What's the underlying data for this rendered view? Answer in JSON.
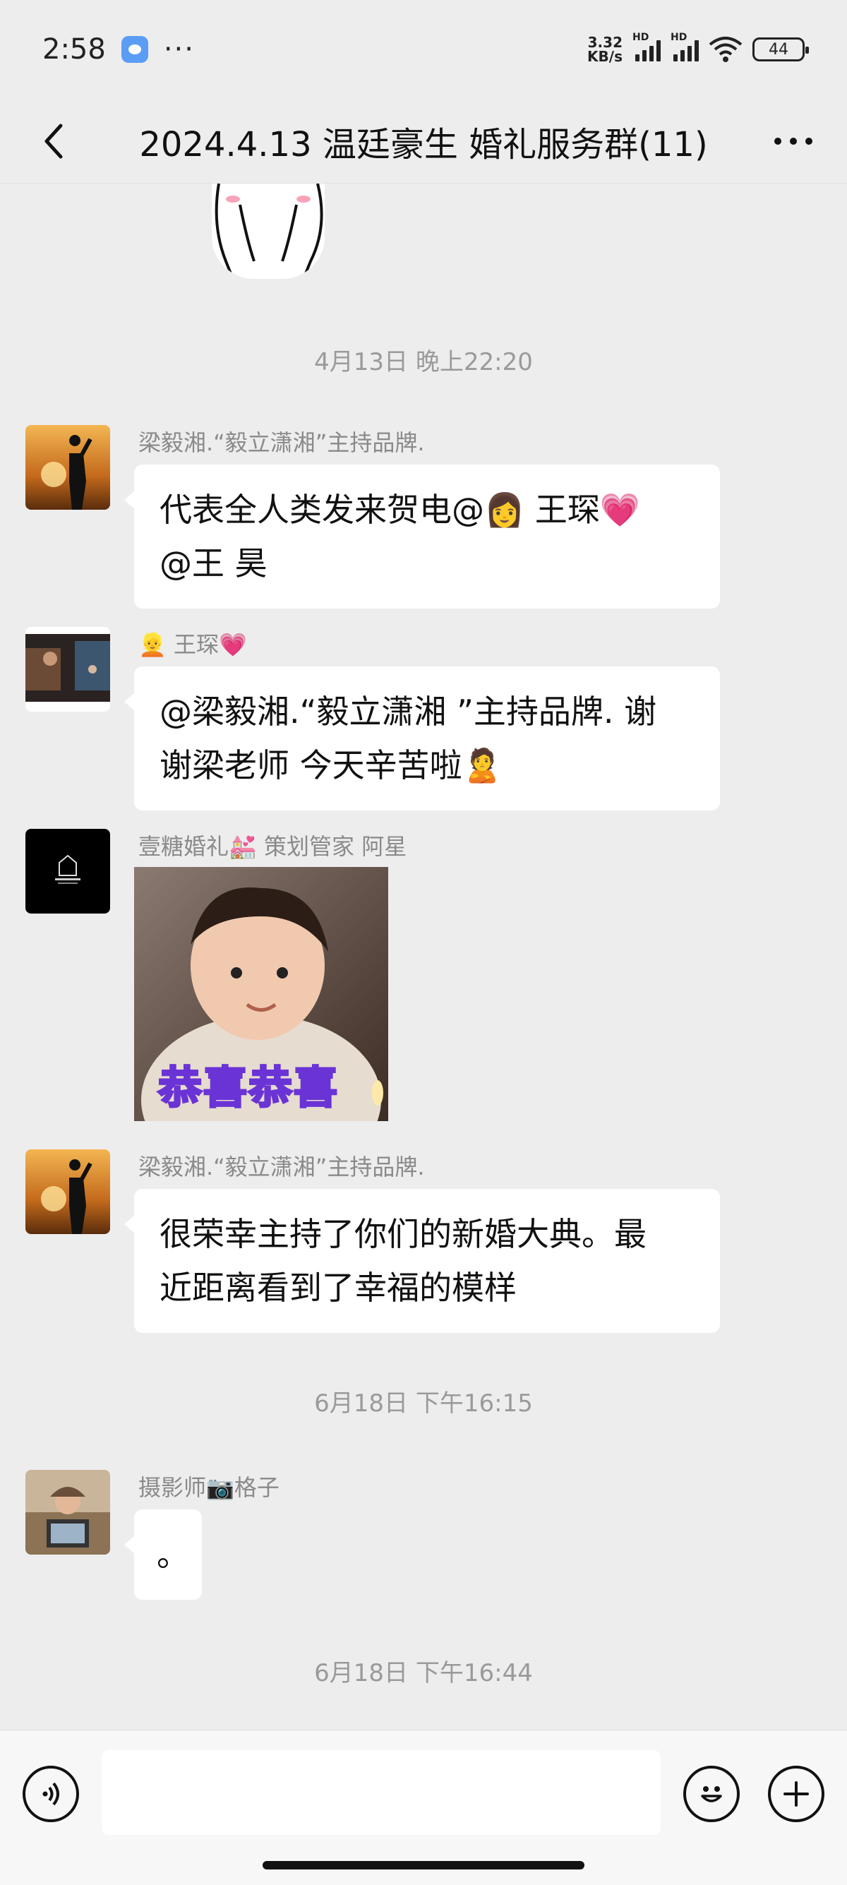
{
  "status_bar": {
    "time": "2:58",
    "dots": "···",
    "net_speed_value": "3.32",
    "net_speed_unit": "KB/s",
    "hd1": "HD",
    "hd2": "HD",
    "battery": "44",
    "icons": [
      "app-badge-icon",
      "signal-icon",
      "wifi-icon",
      "battery-icon"
    ]
  },
  "header": {
    "title": "2024.4.13 温廷豪生 婚礼服务群(11)",
    "back_icon": "chevron-left-icon",
    "more_icon": "more-dots-icon"
  },
  "chat": {
    "timestamps": [
      "4月13日 晚上22:20",
      "6月18日 下午16:15",
      "6月18日 下午16:44"
    ],
    "messages": [
      {
        "sender": "梁毅湘.“毅立潇湘”主持品牌.",
        "text_line1": "代表全人类发来贺电@👩 王琛💗",
        "text_line2": "@王 昊"
      },
      {
        "sender": "👱 王琛💗",
        "text_line1": "@梁毅湘.“毅立潇湘 ”主持品牌. 谢",
        "text_line2": "谢梁老师 今天辛苦啦🙎"
      },
      {
        "sender": "壹糖婚礼💒 策划管家  阿星",
        "image_caption": "恭喜恭喜"
      },
      {
        "sender": "梁毅湘.“毅立潇湘”主持品牌.",
        "text_line1": "很荣幸主持了你们的新婚大典。最",
        "text_line2": "近距离看到了幸福的模样"
      },
      {
        "sender": "摄影师📷格子",
        "text_line1": "。"
      }
    ]
  },
  "input_bar": {
    "voice_icon": "voice-icon",
    "emoji_icon": "emoji-icon",
    "plus_icon": "plus-icon",
    "placeholder": ""
  }
}
